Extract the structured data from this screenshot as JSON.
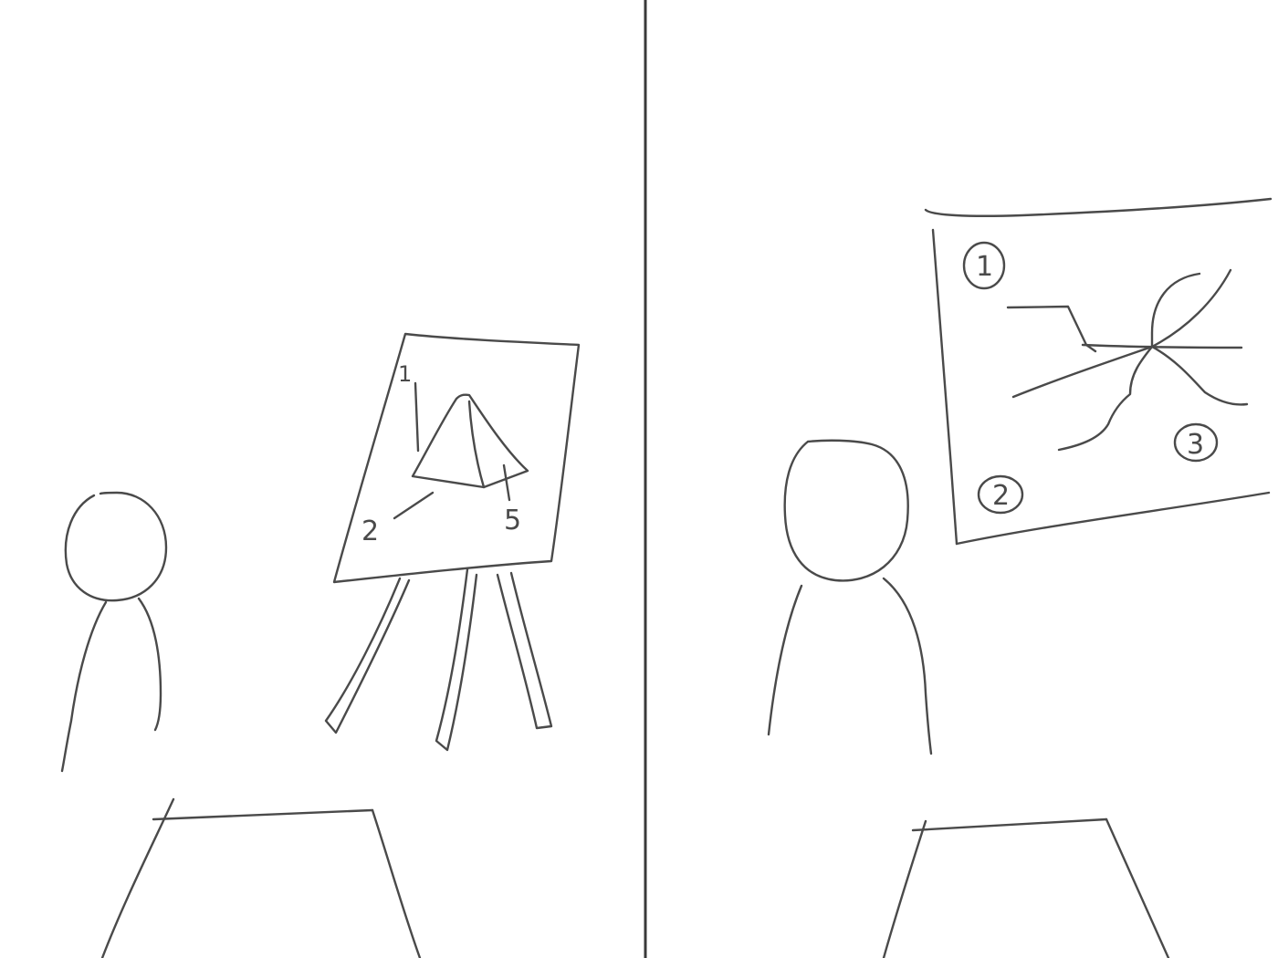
{
  "panels": [
    {
      "easel_labels": [
        "1",
        "2",
        "5"
      ]
    },
    {
      "board_labels": [
        "1",
        "2",
        "3"
      ]
    }
  ],
  "colors": {
    "pencil": "#4a4a4a",
    "background": "#ffffff"
  }
}
